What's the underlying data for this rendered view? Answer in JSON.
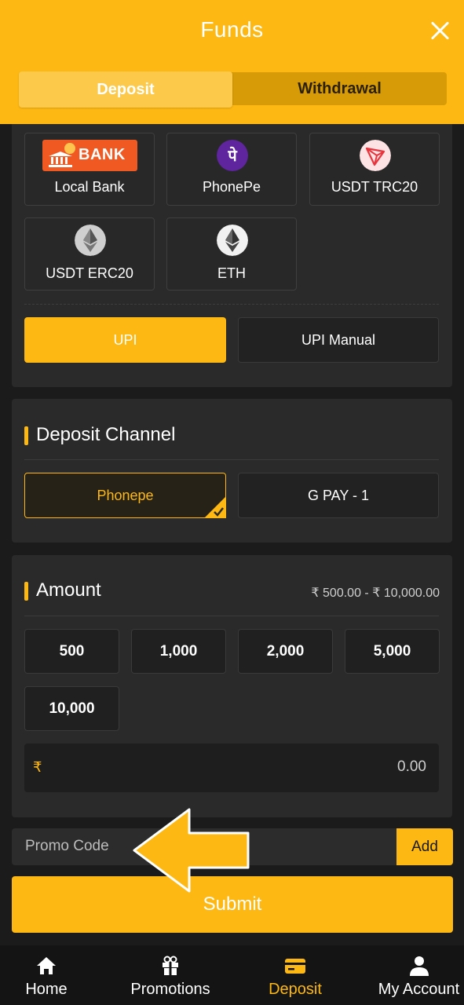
{
  "header": {
    "title": "Funds",
    "close_label": "×"
  },
  "tabs": [
    {
      "label": "Deposit",
      "active": true
    },
    {
      "label": "Withdrawal",
      "active": false
    }
  ],
  "methods": [
    {
      "label": "Local Bank",
      "logo_text": "BANK",
      "icon": "bank-icon"
    },
    {
      "label": "PhonePe",
      "icon": "phonepe-icon"
    },
    {
      "label": "USDT TRC20",
      "icon": "tron-icon"
    },
    {
      "label": "USDT ERC20",
      "icon": "ethereum-icon"
    },
    {
      "label": "ETH",
      "icon": "ethereum-icon"
    }
  ],
  "sub_methods": [
    {
      "label": "UPI",
      "selected": true
    },
    {
      "label": "UPI Manual",
      "selected": false
    }
  ],
  "deposit_channel": {
    "title": "Deposit Channel",
    "options": [
      {
        "label": "Phonepe",
        "selected": true
      },
      {
        "label": "G PAY - 1",
        "selected": false
      }
    ]
  },
  "amount": {
    "title": "Amount",
    "range": "₹ 500.00 - ₹ 10,000.00",
    "presets": [
      "500",
      "1,000",
      "2,000",
      "5,000",
      "10,000"
    ],
    "currency_symbol": "₹",
    "value": "0.00"
  },
  "promo": {
    "placeholder": "Promo Code",
    "add_label": "Add"
  },
  "submit_label": "Submit",
  "bottom_nav": [
    {
      "label": "Home",
      "icon": "home-icon",
      "active": false
    },
    {
      "label": "Promotions",
      "icon": "gift-icon",
      "active": false
    },
    {
      "label": "Deposit",
      "icon": "card-icon",
      "active": true
    },
    {
      "label": "My Account",
      "icon": "user-icon",
      "active": false
    }
  ],
  "colors": {
    "accent": "#fdb813",
    "background": "#1b1b1b",
    "card": "#2a2a2a",
    "phonepe": "#5f259f",
    "tron": "#e8343c"
  }
}
